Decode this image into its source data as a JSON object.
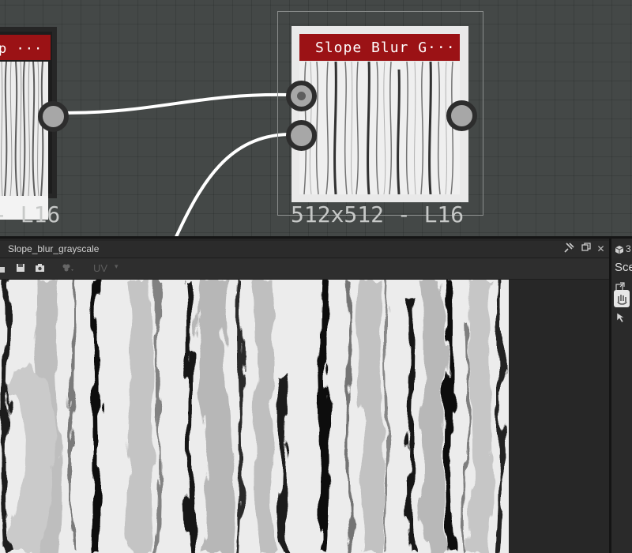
{
  "graph": {
    "left_node": {
      "title": "p ···",
      "footer": "- L16"
    },
    "main_node": {
      "title": "Slope Blur G···",
      "footer": "512x512 - L16",
      "header_color": "#9b1215"
    }
  },
  "view": {
    "title": "Slope_blur_grayscale",
    "toolbar": {
      "uv_label": "UV",
      "uv_caret": "▾"
    },
    "title_buttons": {
      "pin": "pin-icon",
      "restore": "restore-icon",
      "close": "✕"
    }
  },
  "right_panel": {
    "tab_number": "3",
    "scene_label": "Sce"
  }
}
